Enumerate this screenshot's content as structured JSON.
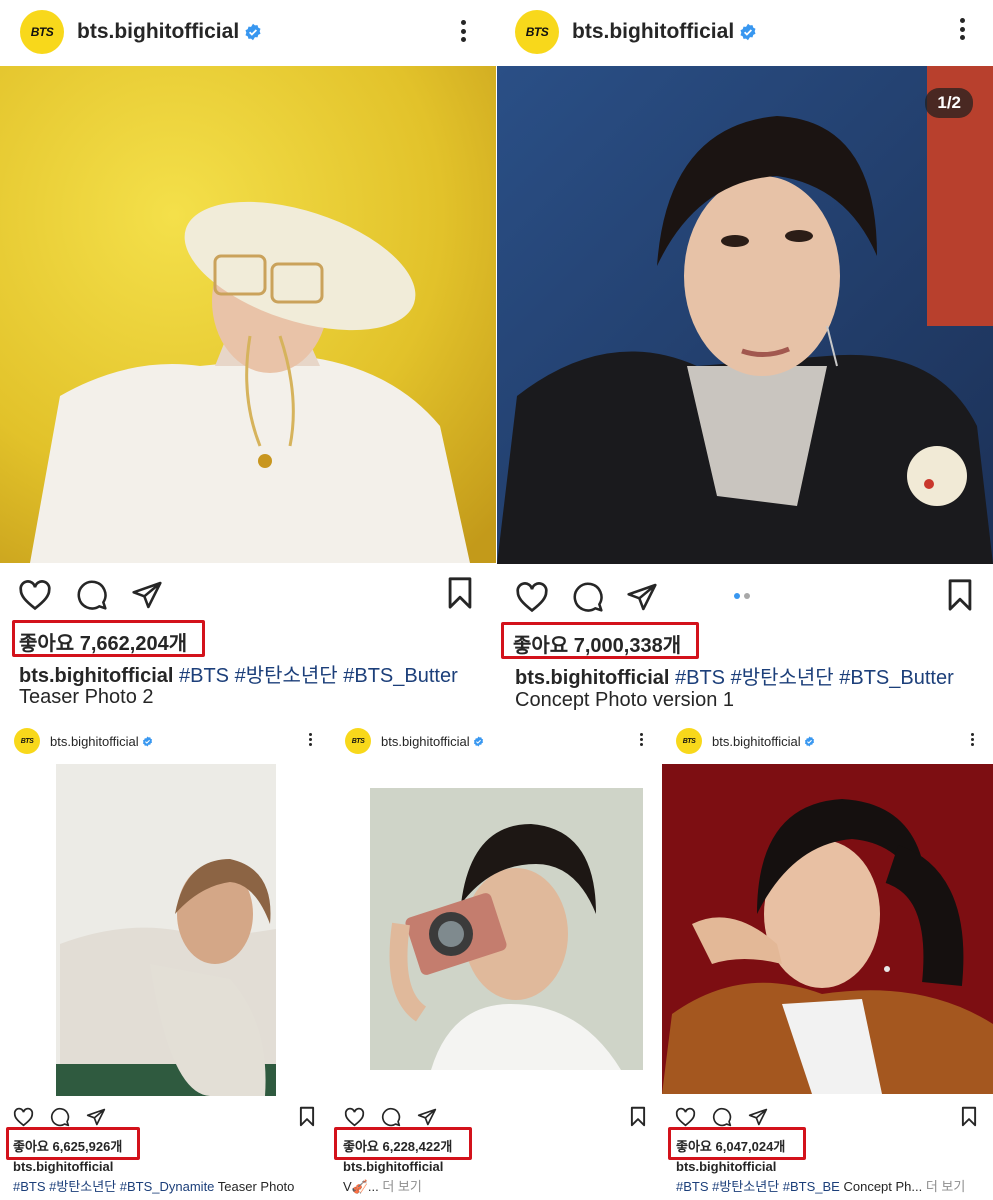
{
  "posts": [
    {
      "username": "bts.bighitofficial",
      "avatar_text": "BTS",
      "likes": "좋아요 7,662,204개",
      "caption_user": "bts.bighitofficial",
      "hashtags": "#BTS #방탄소년단 #BTS_Butter",
      "caption_line2": "Teaser Photo 2"
    },
    {
      "username": "bts.bighitofficial",
      "avatar_text": "BTS",
      "image_counter": "1/2",
      "likes": "좋아요 7,000,338개",
      "caption_user": "bts.bighitofficial",
      "hashtags": "#BTS #방탄소년단 #BTS_Butter",
      "caption_line2": "Concept Photo version 1"
    },
    {
      "username": "bts.bighitofficial",
      "avatar_text": "BTS",
      "likes": "좋아요 6,625,926개",
      "caption_user": "bts.bighitofficial",
      "hashtags": "#BTS #방탄소년단 #BTS_Dynamite",
      "caption_rest": " Teaser Photo"
    },
    {
      "username": "bts.bighitofficial",
      "avatar_text": "BTS",
      "likes": "좋아요 6,228,422개",
      "caption_user": "bts.bighitofficial",
      "caption_text": "V🎻...",
      "more_label": " 더 보기"
    },
    {
      "username": "bts.bighitofficial",
      "avatar_text": "BTS",
      "likes": "좋아요 6,047,024개",
      "caption_user": "bts.bighitofficial",
      "hashtags": "#BTS #방탄소년단 #BTS_BE",
      "caption_rest": " Concept Ph...",
      "more_label": " 더 보기"
    }
  ],
  "colors": {
    "highlight_box": "#d3121b",
    "avatar_bg": "#f8d81b",
    "verified": "#3897f0",
    "hashtag": "#1c3f7a"
  },
  "icons": [
    "heart-icon",
    "comment-icon",
    "share-icon",
    "bookmark-icon",
    "more-options-icon",
    "verified-badge-icon"
  ]
}
